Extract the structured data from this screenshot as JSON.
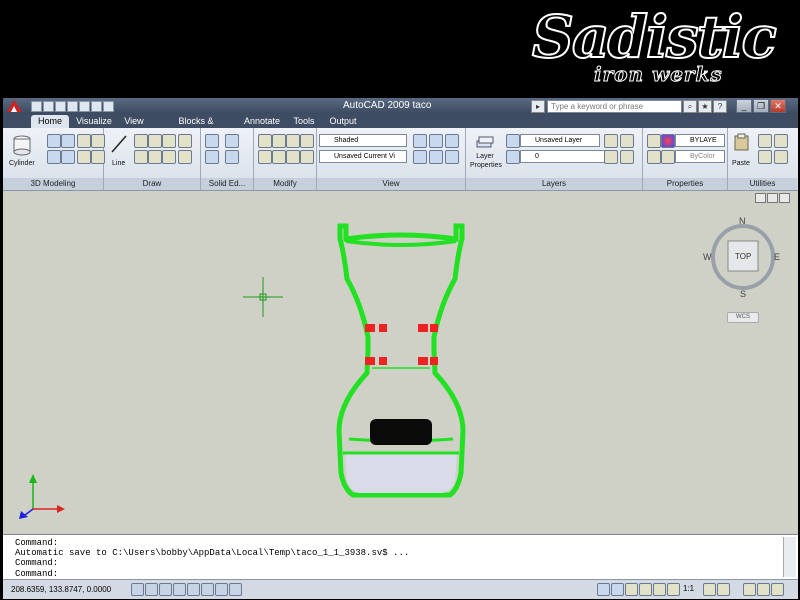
{
  "brand": {
    "line1": "Sadistic",
    "line2": "iron werks"
  },
  "window": {
    "title": "AutoCAD 2009 taco",
    "search_placeholder": "Type a keyword or phrase"
  },
  "tabs": [
    "Home",
    "Visualize",
    "View",
    "Blocks & References",
    "Annotate",
    "Tools",
    "Output"
  ],
  "ribbon": {
    "panels": [
      "3D Modeling",
      "Draw",
      "Solid Ed...",
      "Modify",
      "View",
      "Layers",
      "Properties",
      "Utilities"
    ],
    "cylinder_label": "Cylinder",
    "line_label": "Line",
    "visual_style": "Shaded",
    "view_combo": "Unsaved Current Vi",
    "layer_props_label": "Layer Properties",
    "layer_state": "Unsaved Layer",
    "layer_current": "0",
    "color_value": "BYLAYE",
    "bycolor": "ByColor",
    "paste_label": "Paste"
  },
  "viewcube": {
    "face": "TOP",
    "n": "N",
    "s": "S",
    "e": "E",
    "w": "W",
    "ucs": "WCS"
  },
  "command": {
    "lines": [
      "Command:",
      "Automatic save to C:\\Users\\bobby\\AppData\\Local\\Temp\\taco_1_1_3938.sv$ ...",
      "Command:",
      "Command:"
    ]
  },
  "status": {
    "coords": "208.6359, 133.8747, 0.0000",
    "scale": "1:1"
  },
  "colors": {
    "frame": "#22e022",
    "tab_accent": "#3f4d64",
    "viewport_bg": "#cfd1c6"
  }
}
